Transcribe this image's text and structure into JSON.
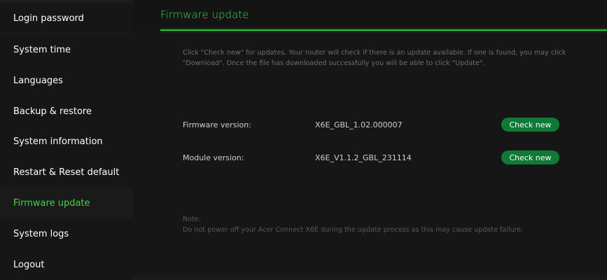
{
  "sidebar": {
    "items": [
      {
        "label": "Login password"
      },
      {
        "label": "System time"
      },
      {
        "label": "Languages"
      },
      {
        "label": "Backup & restore"
      },
      {
        "label": "System information"
      },
      {
        "label": "Restart & Reset default"
      },
      {
        "label": "Firmware update",
        "active": true
      },
      {
        "label": "System logs"
      },
      {
        "label": "Logout"
      }
    ]
  },
  "main": {
    "title": "Firmware update",
    "description": "Click \"Check new\" for updates. Your router will check if there is an update available. If one is found, you may click \"Download\". Once the file has downloaded successfully you will be able to click \"Update\".",
    "firmware": {
      "label": "Firmware version:",
      "value": "X6E_GBL_1.02.000007",
      "button": "Check new"
    },
    "module": {
      "label": "Module version:",
      "value": "X6E_V1.1.2_GBL_231114",
      "button": "Check new"
    },
    "note_title": "Note:",
    "note_text": "Do not power off your Acer Connect X6E during the update process as this may cause update failure."
  },
  "colors": {
    "accent": "#43d14b",
    "button": "#0e7a36",
    "background": "#161616"
  }
}
